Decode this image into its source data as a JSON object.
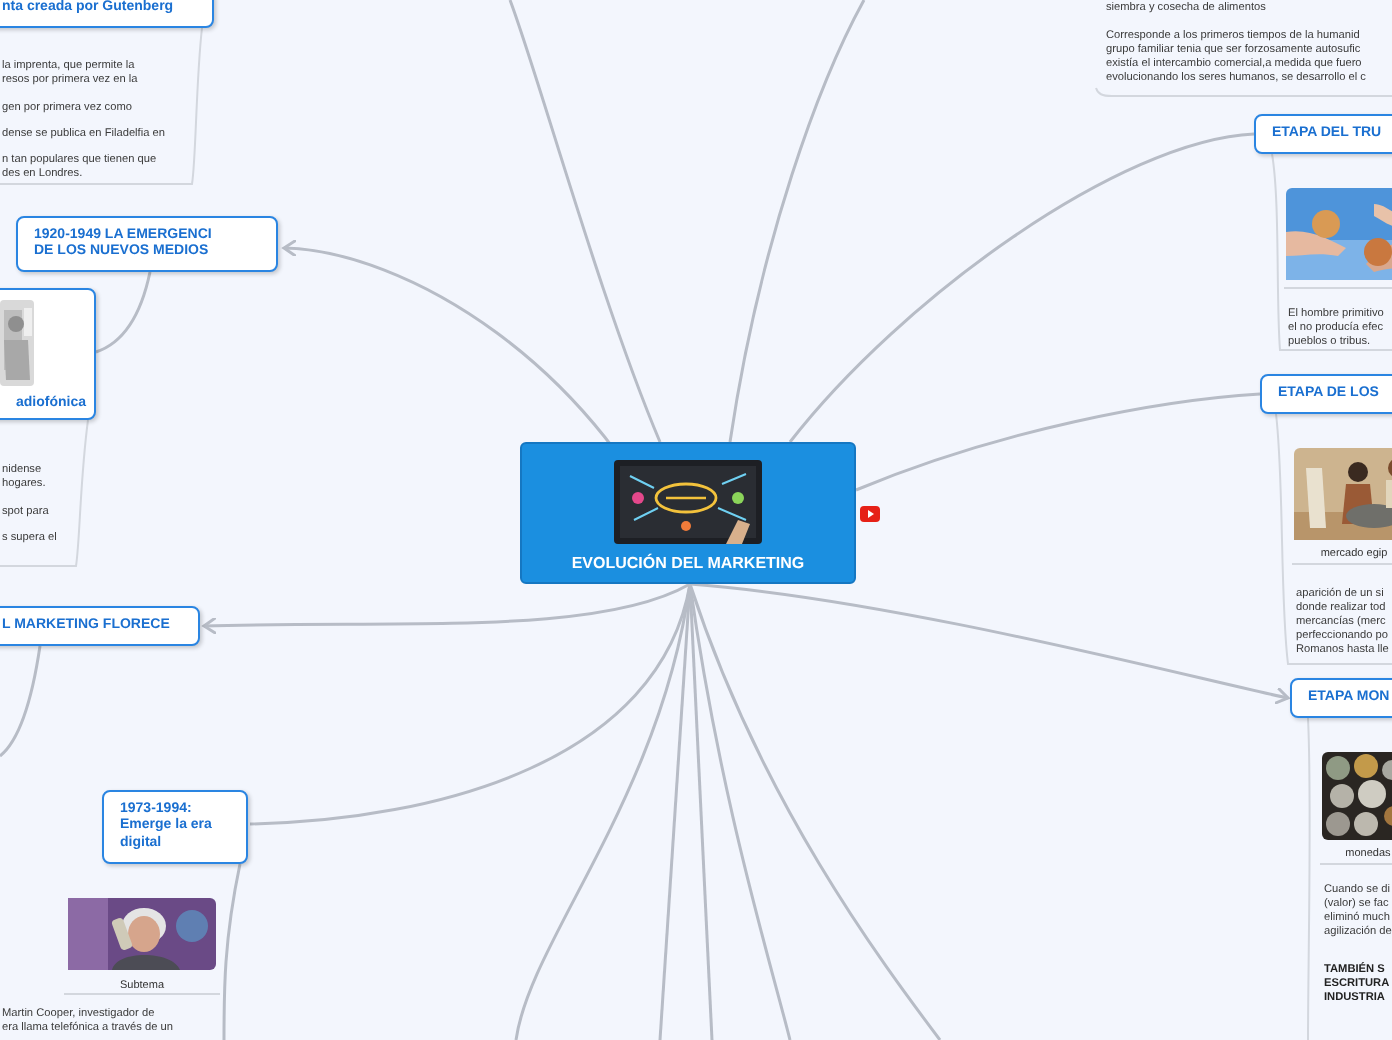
{
  "central_topic": {
    "title": "EVOLUCIÓN DEL MARKETING"
  },
  "topics": [
    {
      "text": "nta creada por Gutenberg"
    },
    {
      "text": "1920-1949 LA EMERGENCI\nDE LOS NUEVOS MEDIOS"
    },
    {
      "text": "L MARKETING FLORECE"
    },
    {
      "text": "1973-1994:\nEmerge la era\ndigital"
    },
    {
      "text": "ETAPA DEL TRU"
    },
    {
      "text": "ETAPA DE LOS"
    },
    {
      "text": "ETAPA MON"
    }
  ],
  "image_cards": [
    {
      "kind": "topic",
      "caption": "adiofónica"
    },
    {
      "kind": "subtopic",
      "caption": "Subtema"
    },
    {
      "kind": "subtopic"
    },
    {
      "kind": "subtopic",
      "caption": "mercado egip"
    },
    {
      "kind": "subtopic",
      "caption": "monedas"
    }
  ],
  "notes": [
    {
      "kind": "plain",
      "text": "la imprenta, que permite la\nresos por primera vez en la"
    },
    {
      "kind": "plain",
      "text": "gen por primera vez como"
    },
    {
      "kind": "plain",
      "text": "dense se publica en Filadelfia en"
    },
    {
      "kind": "plain",
      "text": "n tan populares que tienen que\ndes en Londres."
    },
    {
      "kind": "plain",
      "text": "nidense\nhogares."
    },
    {
      "kind": "plain",
      "text": "spot para"
    },
    {
      "kind": "plain",
      "text": "s supera el"
    },
    {
      "kind": "plain",
      "text": "Martin Cooper, investigador de\nera llama telefónica a través de un"
    },
    {
      "kind": "plain",
      "text": "siembra y cosecha de alimentos"
    },
    {
      "kind": "plain",
      "text": "Corresponde a los primeros tiempos de la humanid\ngrupo familiar tenia que ser forzosamente autosufic\nexistía el intercambio comercial,a medida que fuero\nevolucionando los seres humanos, se desarrollo el c"
    },
    {
      "kind": "plain",
      "text": "El hombre primitivo\nel no producía efec\npueblos o tribus."
    },
    {
      "kind": "plain",
      "text": "aparición de un si\ndonde realizar tod\nmercancías (merc\nperfeccionando po\nRomanos hasta lle"
    },
    {
      "kind": "plain",
      "text": "Cuando se di\n(valor) se fac\neliminó much\nagilización de"
    },
    {
      "kind": "bold",
      "text": "TAMBIÉN S\nESCRITURA\nINDUSTRIA"
    }
  ]
}
